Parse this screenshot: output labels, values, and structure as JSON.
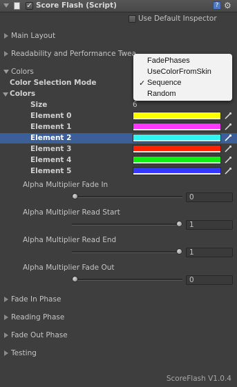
{
  "header": {
    "title": "Score Flash (Script)",
    "help_icon": "help-icon",
    "settings_icon": "gear-icon",
    "use_default_inspector_label": "Use Default Inspector",
    "use_default_inspector_checked": false,
    "enabled_checked": true
  },
  "sections": {
    "main_layout": "Main Layout",
    "readability": "Readability and Performance Twea",
    "colors_section": "Colors",
    "fade_in_phase": "Fade In Phase",
    "reading_phase": "Reading Phase",
    "fade_out_phase": "Fade Out Phase",
    "testing": "Testing"
  },
  "colors": {
    "selection_mode_label": "Color Selection Mode",
    "colors_label": "Colors",
    "size_label": "Size",
    "size_value": "6",
    "elements": [
      {
        "label": "Element 0",
        "color": "#ffff00"
      },
      {
        "label": "Element 1",
        "color": "#ff38ff"
      },
      {
        "label": "Element 2",
        "color": "#33f2f2"
      },
      {
        "label": "Element 3",
        "color": "#ff2200"
      },
      {
        "label": "Element 4",
        "color": "#11ee11"
      },
      {
        "label": "Element 5",
        "color": "#3338ff"
      }
    ],
    "selected_element": 2
  },
  "sliders": [
    {
      "label": "Alpha Multiplier Fade In",
      "value": "0",
      "fraction": 0
    },
    {
      "label": "Alpha Multiplier Read Start",
      "value": "1",
      "fraction": 1
    },
    {
      "label": "Alpha Multiplier Read End",
      "value": "1",
      "fraction": 1
    },
    {
      "label": "Alpha Multiplier Fade Out",
      "value": "0",
      "fraction": 0
    }
  ],
  "dropdown": {
    "options": [
      "FadePhases",
      "UseColorFromSkin",
      "Sequence",
      "Random"
    ],
    "selected": "Sequence",
    "check_mark": "✓"
  },
  "footer": {
    "version": "ScoreFlash V1.0.4"
  }
}
